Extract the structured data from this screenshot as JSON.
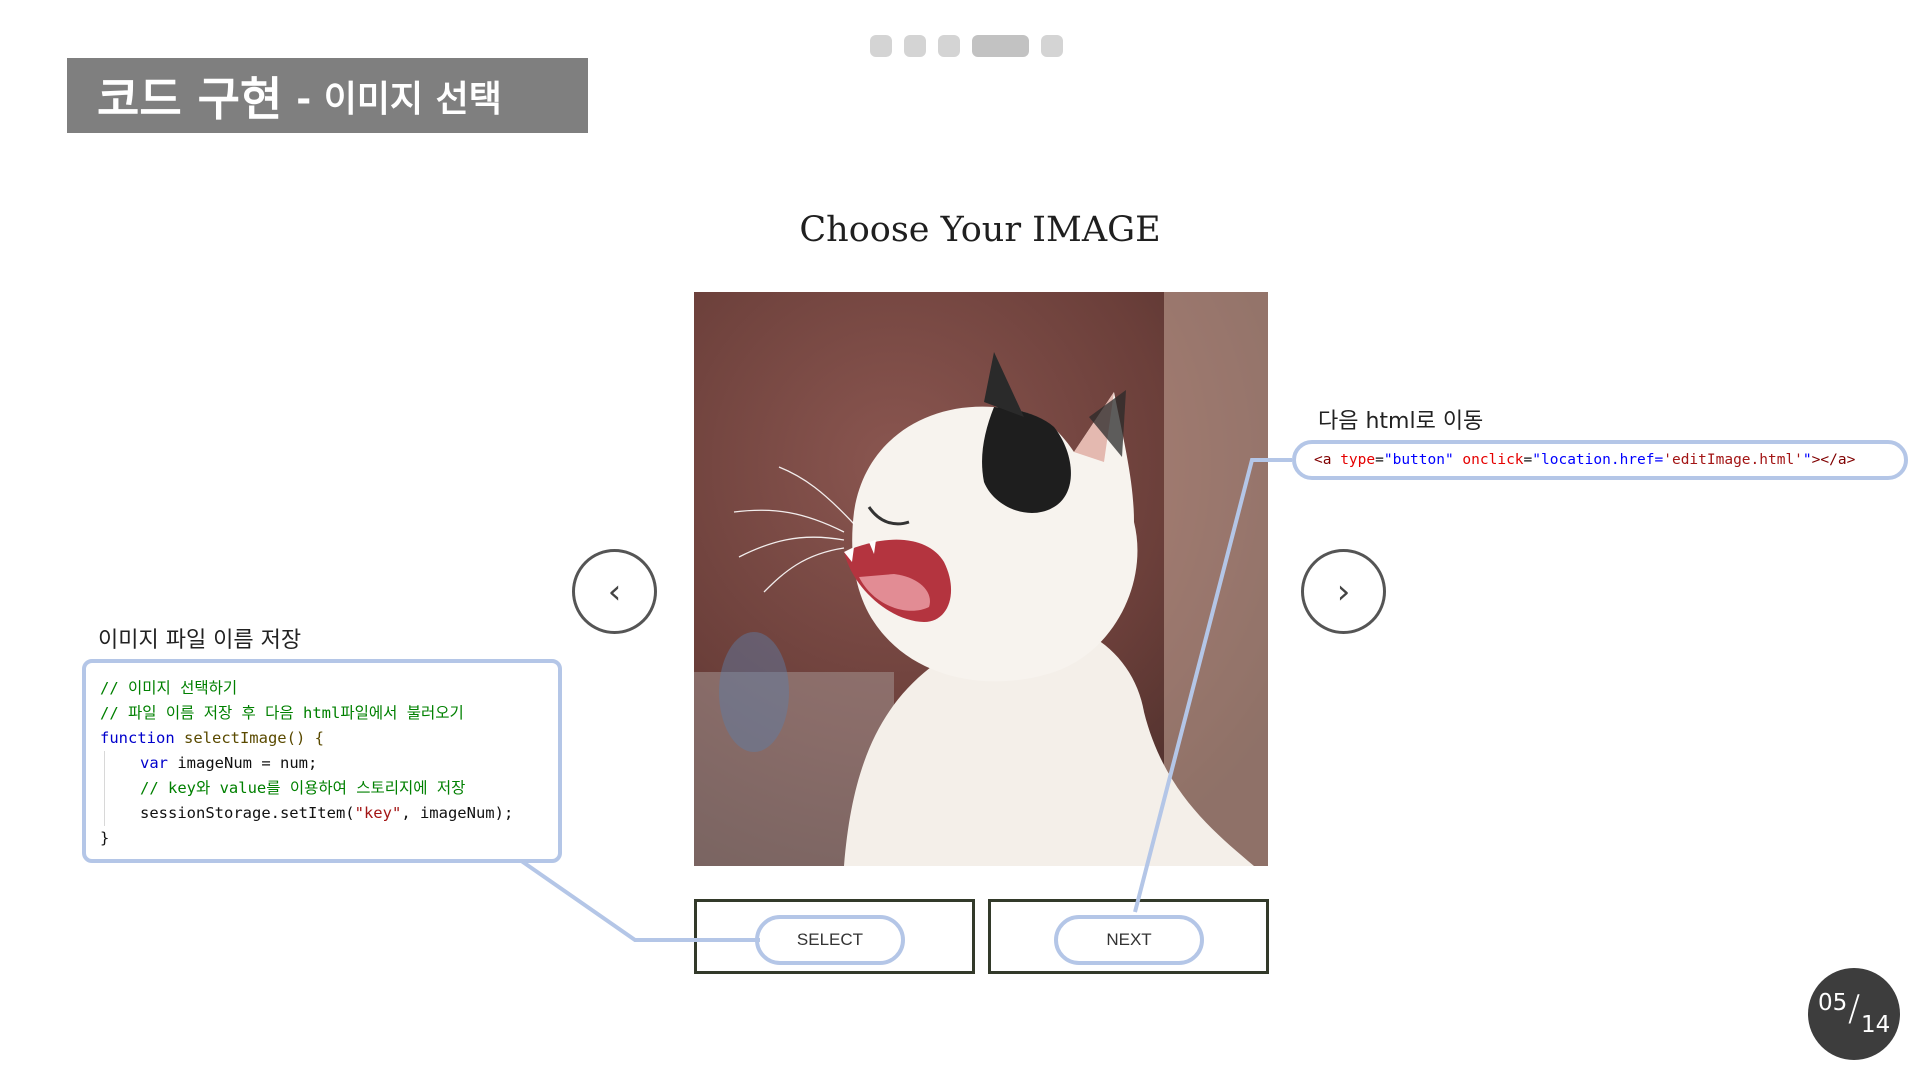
{
  "slide": {
    "title": "코드 구현",
    "subtitle": "- 이미지 선택",
    "page_current": "05",
    "page_total": "14",
    "progress_dots": 5,
    "active_dot_index": 3
  },
  "ui": {
    "heading": "Choose Your IMAGE",
    "prev_icon": "‹",
    "next_icon": "›",
    "select_label": "SELECT",
    "next_label": "NEXT",
    "image_icon": "yawning-cat-photo"
  },
  "annotations": {
    "left_label": "이미지 파일 이름 저장",
    "right_label": "다음 html로 이동",
    "left_code": {
      "line1": "// 이미지 선택하기",
      "line2": "// 파일 이름 저장 후 다음 html파일에서 불러오기",
      "line3_kw": "function",
      "line3_rest": " selectImage() {",
      "line4_kw": "var",
      "line4_rest": " imageNum = num;",
      "line5": "// key와 value를 이용하여 스토리지에 저장",
      "line6_a": "sessionStorage.setItem(",
      "line6_str": "\"key\"",
      "line6_b": ", imageNum);",
      "line7": "}"
    },
    "right_code": {
      "tag_open": "<a",
      "attr1": " type",
      "eq1": "=",
      "val1": "\"button\"",
      "attr2": " onclick",
      "eq2": "=",
      "val2a": "\"location.href=",
      "val2b": "'editImage.html'",
      "val2c": "\"",
      "tag_close": "></a>"
    }
  },
  "colors": {
    "accent_outline": "#b4c6e7",
    "title_bg": "#7f7f7f",
    "badge_bg": "#3d3d3d"
  }
}
